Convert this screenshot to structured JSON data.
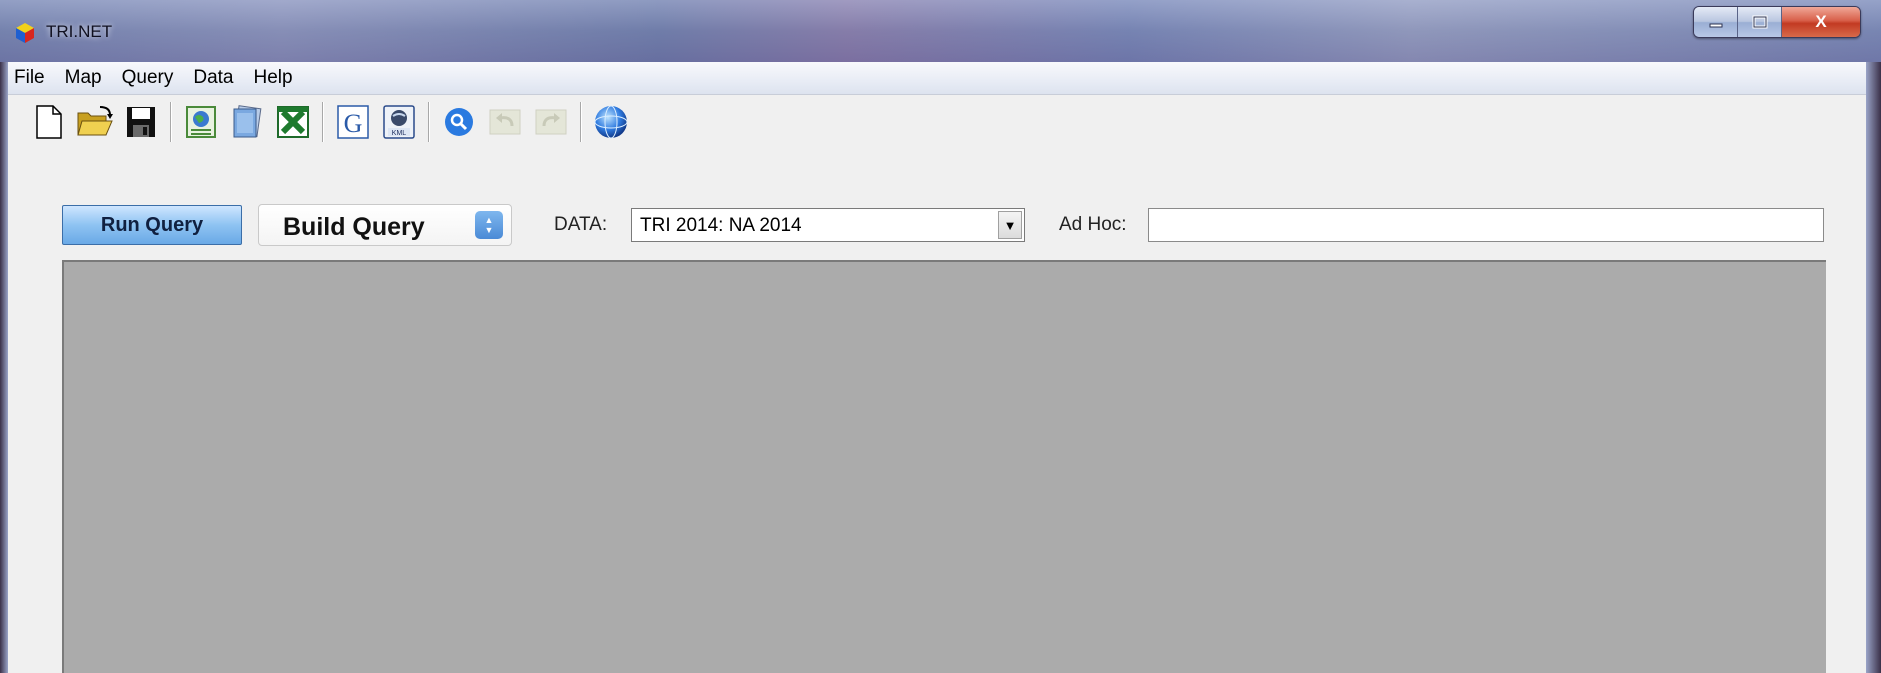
{
  "window": {
    "title": "TRI.NET",
    "controls": {
      "minimize": "–",
      "maximize": "□",
      "close": "X"
    }
  },
  "menu": [
    "File",
    "Map",
    "Query",
    "Data",
    "Help"
  ],
  "toolbar": {
    "groups": [
      [
        "new-document-icon",
        "open-folder-icon",
        "save-disk-icon"
      ],
      [
        "map-globe-icon",
        "report-icon",
        "excel-icon"
      ],
      [
        "google-icon",
        "kml-icon"
      ],
      [
        "search-icon",
        "undo-icon",
        "redo-icon"
      ],
      [
        "earth-globe-icon"
      ]
    ]
  },
  "query": {
    "run_label": "Run Query",
    "build_label": "Build Query",
    "data_label": "DATA:",
    "data_value": "TRI 2014: NA 2014",
    "adhoc_label": "Ad Hoc:",
    "adhoc_value": ""
  },
  "colors": {
    "run_button": "#8ec3f2",
    "results_panel": "#ababab",
    "client_bg": "#f0f0f0"
  }
}
